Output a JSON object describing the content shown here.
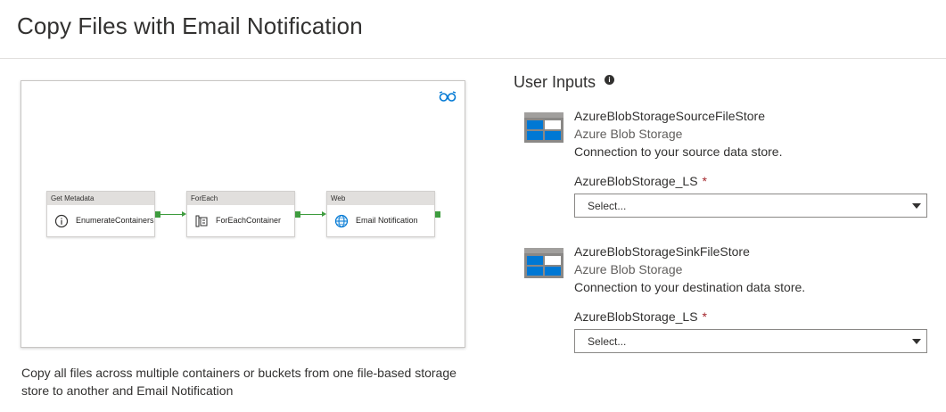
{
  "page": {
    "title": "Copy Files with Email Notification"
  },
  "preview": {
    "activities": [
      {
        "type": "Get Metadata",
        "name": "EnumerateContainers.",
        "icon": "info-circle-icon"
      },
      {
        "type": "ForEach",
        "name": "ForEachContainer",
        "icon": "foreach-icon"
      },
      {
        "type": "Web",
        "name": "Email Notification",
        "icon": "web-globe-icon"
      }
    ],
    "connector_color": "#3e9c3e",
    "preview_icon": "glasses-icon"
  },
  "description": "Copy all files across multiple containers or buckets from one file-based storage store to another and Email Notification",
  "user_inputs": {
    "title": "User Inputs",
    "info_icon": "info-icon",
    "stores": [
      {
        "name": "AzureBlobStorageSourceFileStore",
        "type": "Azure Blob Storage",
        "description": "Connection to your source data store.",
        "field_label": "AzureBlobStorage_LS",
        "required_mark": "*",
        "selected_value": "Select..."
      },
      {
        "name": "AzureBlobStorageSinkFileStore",
        "type": "Azure Blob Storage",
        "description": "Connection to your destination data store.",
        "field_label": "AzureBlobStorage_LS",
        "required_mark": "*",
        "selected_value": "Select..."
      }
    ]
  },
  "colors": {
    "required": "#a4262c",
    "azure_blue": "#0078d4"
  }
}
